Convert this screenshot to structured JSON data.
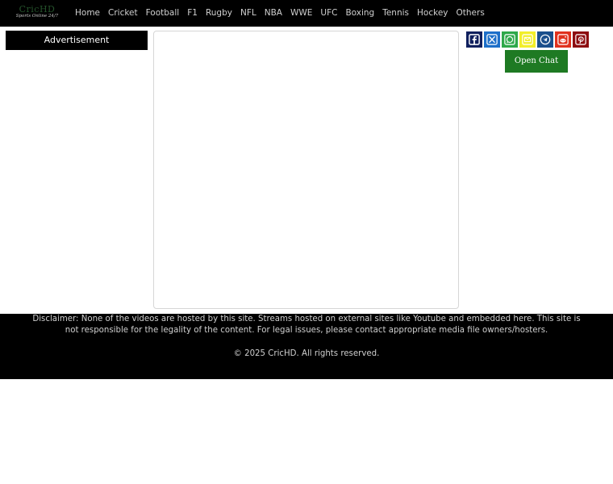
{
  "logo": {
    "main": "CricHD",
    "tagline": "Sports Online 24/7"
  },
  "nav": {
    "items": [
      "Home",
      "Cricket",
      "Football",
      "F1",
      "Rugby",
      "NFL",
      "NBA",
      "WWE",
      "UFC",
      "Boxing",
      "Tennis",
      "Hockey",
      "Others"
    ]
  },
  "sidebar": {
    "ad_label": "Advertisement"
  },
  "share": {
    "buttons": [
      {
        "name": "facebook-icon",
        "color": "#10205e"
      },
      {
        "name": "x-icon",
        "color": "#1d6fc9"
      },
      {
        "name": "whatsapp-icon",
        "color": "#2ea84a"
      },
      {
        "name": "email-icon",
        "color": "#f2ee2a"
      },
      {
        "name": "telegram-icon",
        "color": "#1a4f8c"
      },
      {
        "name": "reddit-icon",
        "color": "#e0321e"
      },
      {
        "name": "pinterest-icon",
        "color": "#8d0c10"
      }
    ]
  },
  "chat": {
    "label": "Open Chat"
  },
  "footer": {
    "disclaimer": "Disclaimer: None of the videos are hosted by this site. Streams hosted on external sites like Youtube and embedded here. This site is not responsible for the legality of the content. For legal issues, please contact appropriate media file owners/hosters.",
    "copyright": "© 2025 CricHD. All rights reserved."
  }
}
